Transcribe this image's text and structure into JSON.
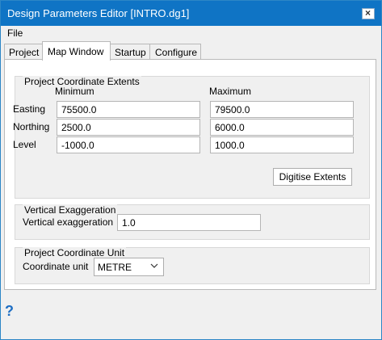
{
  "window": {
    "title": "Design Parameters Editor [INTRO.dg1]"
  },
  "menu": {
    "file": "File"
  },
  "tabs": [
    "Project",
    "Map Window",
    "Startup",
    "Configure"
  ],
  "coord_extents": {
    "title": "Project Coordinate Extents",
    "minimum_label": "Minimum",
    "maximum_label": "Maximum",
    "rows": [
      {
        "label": "Easting",
        "min": "75500.0",
        "max": "79500.0"
      },
      {
        "label": "Northing",
        "min": "2500.0",
        "max": "6000.0"
      },
      {
        "label": "Level",
        "min": "-1000.0",
        "max": "1000.0"
      }
    ],
    "digitise_button": "Digitise Extents"
  },
  "vertical": {
    "title": "Vertical Exaggeration",
    "label": "Vertical exaggeration",
    "value": "1.0"
  },
  "unit": {
    "title": "Project Coordinate Unit",
    "label": "Coordinate unit",
    "value": "METRE"
  },
  "help": {
    "glyph": "?"
  }
}
